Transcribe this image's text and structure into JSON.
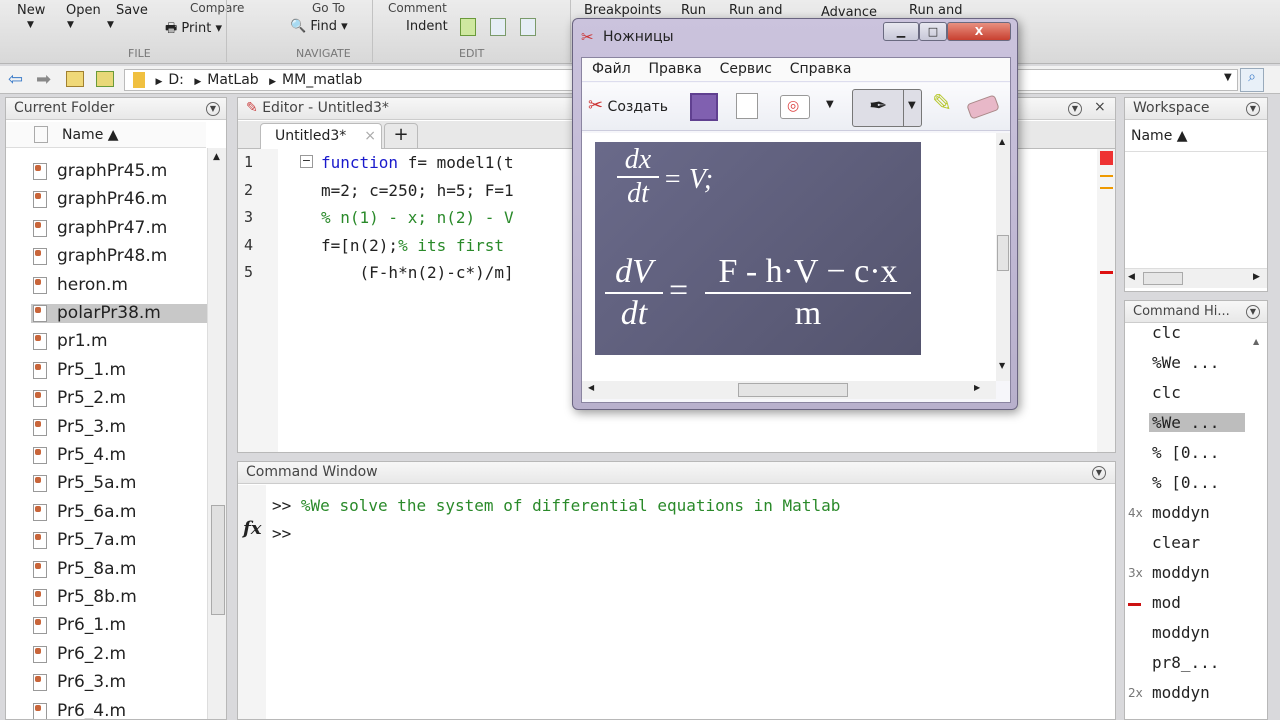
{
  "toolbar": {
    "new": "New",
    "open": "Open",
    "save": "Save",
    "compare": "Compare",
    "print": "Print",
    "goto": "Go To",
    "find": "Find",
    "comment": "Comment",
    "indent": "Indent",
    "breakpoints": "Breakpoints",
    "run": "Run",
    "run_and": "Run and",
    "advance": "Advance",
    "run_and2": "Run and",
    "sections": {
      "file": "FILE",
      "navigate": "NAVIGATE",
      "edit": "EDIT"
    }
  },
  "address": {
    "path": [
      "D:",
      "MatLab",
      "MM_matlab"
    ]
  },
  "current_folder": {
    "title": "Current Folder",
    "col": "Name ▲",
    "files": [
      "graphPr45.m",
      "graphPr46.m",
      "graphPr47.m",
      "graphPr48.m",
      "heron.m",
      "polarPr38.m",
      "pr1.m",
      "Pr5_1.m",
      "Pr5_2.m",
      "Pr5_3.m",
      "Pr5_4.m",
      "Pr5_5a.m",
      "Pr5_6a.m",
      "Pr5_7a.m",
      "Pr5_8a.m",
      "Pr5_8b.m",
      "Pr6_1.m",
      "Pr6_2.m",
      "Pr6_3.m",
      "Pr6_4.m"
    ],
    "selected": "polarPr38.m"
  },
  "editor": {
    "title": "Editor - Untitled3*",
    "tab": "Untitled3*",
    "new_tab": "+",
    "lines": [
      {
        "n": "1",
        "parts": [
          {
            "t": "function",
            "c": "kw"
          },
          {
            "t": " f= model1(t",
            "c": ""
          }
        ]
      },
      {
        "n": "2",
        "parts": [
          {
            "t": "m=2; c=250; h=5; F=1",
            "c": ""
          }
        ]
      },
      {
        "n": "3",
        "parts": [
          {
            "t": "% n(1) - x; n(2) - V",
            "c": "cm"
          }
        ]
      },
      {
        "n": "4",
        "parts": [
          {
            "t": "f=[n(2);",
            "c": ""
          },
          {
            "t": "% its first",
            "c": "cm"
          }
        ]
      },
      {
        "n": "5",
        "parts": [
          {
            "t": "    (F-h*n(2)-c*)/m]",
            "c": ""
          }
        ]
      }
    ]
  },
  "command_window": {
    "title": "Command Window",
    "lines": [
      ">> %We solve the system of differential equations in Matlab",
      ">>"
    ],
    "prompt": ">>",
    "comment": "%We solve the system of differential equations in Matlab",
    "fx": "fx"
  },
  "workspace": {
    "title": "Workspace",
    "col": "Name ▲"
  },
  "history": {
    "title": "Command Hi...",
    "items": [
      {
        "t": "clc",
        "c": "",
        "n": ""
      },
      {
        "t": "%We ...",
        "c": "cm",
        "n": ""
      },
      {
        "t": "clc",
        "c": "",
        "n": ""
      },
      {
        "t": "%We ...",
        "c": "cm",
        "n": "",
        "sel": true
      },
      {
        "t": "% [0...",
        "c": "cm",
        "n": ""
      },
      {
        "t": "% [0...",
        "c": "cm",
        "n": ""
      },
      {
        "t": "moddyn",
        "c": "",
        "n": "4x"
      },
      {
        "t": "clear",
        "c": "",
        "n": ""
      },
      {
        "t": "moddyn",
        "c": "",
        "n": "3x"
      },
      {
        "t": "mod",
        "c": "",
        "n": "err"
      },
      {
        "t": "moddyn",
        "c": "",
        "n": ""
      },
      {
        "t": "pr8_...",
        "c": "",
        "n": ""
      },
      {
        "t": "moddyn",
        "c": "",
        "n": "2x"
      }
    ]
  },
  "snip": {
    "title": "Ножницы",
    "menu": [
      "Файл",
      "Правка",
      "Сервис",
      "Справка"
    ],
    "create": "Создать",
    "formula": {
      "l1n": "dx",
      "l1d": "dt",
      "l1r": "= V;",
      "l2n": "dV",
      "l2d": "dt",
      "l2num": "F - h·V − c·x",
      "l2den": "m"
    }
  }
}
